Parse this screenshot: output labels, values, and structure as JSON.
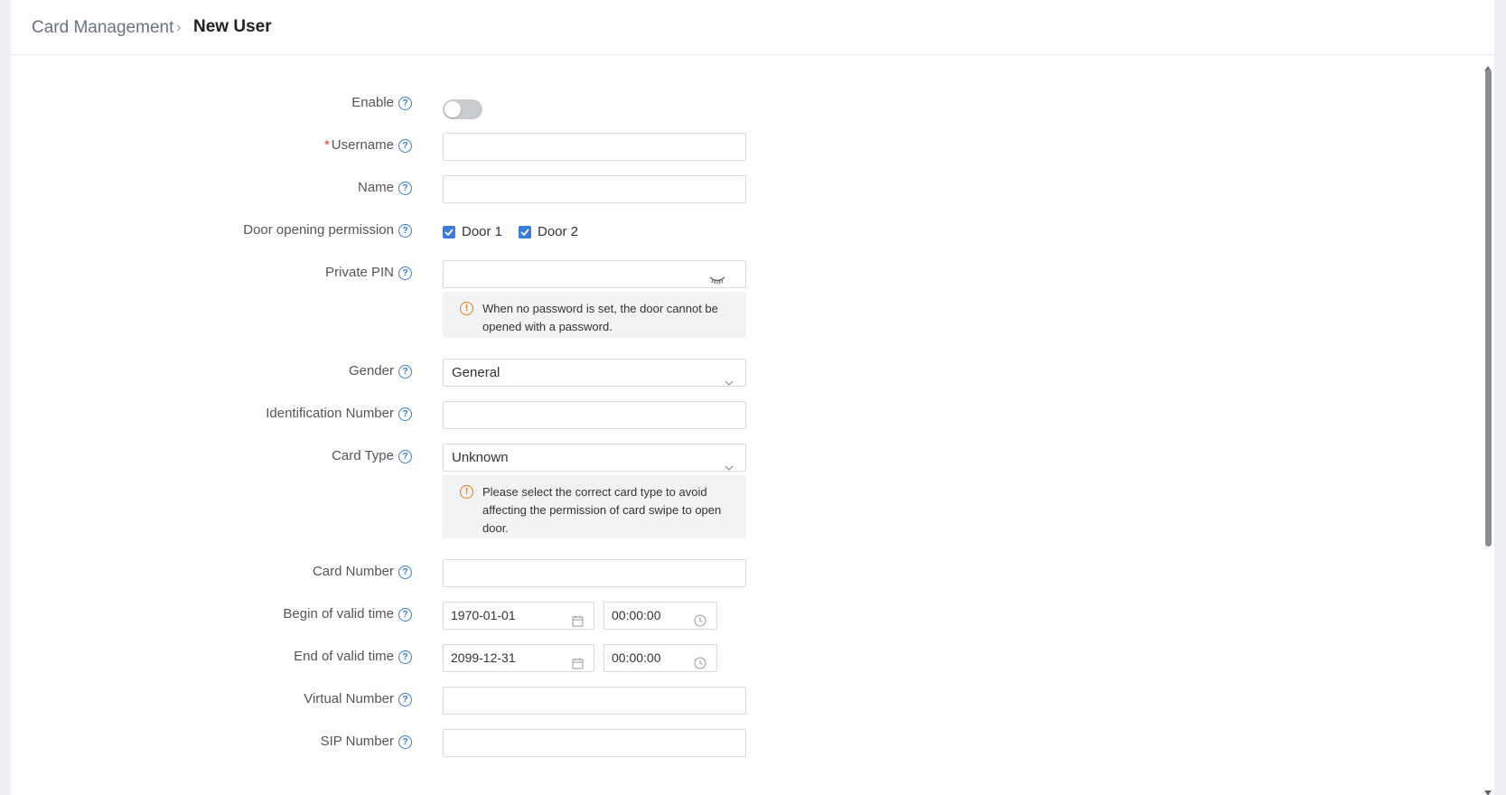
{
  "breadcrumb": {
    "parent": "Card Management",
    "separator": "›",
    "current": "New User"
  },
  "form": {
    "enable": {
      "label": "Enable",
      "state": "off"
    },
    "username": {
      "label": "Username",
      "required_mark": "*",
      "value": ""
    },
    "name": {
      "label": "Name",
      "value": ""
    },
    "door_permission": {
      "label": "Door opening permission",
      "options": [
        {
          "label": "Door 1",
          "checked": true
        },
        {
          "label": "Door 2",
          "checked": true
        }
      ]
    },
    "private_pin": {
      "label": "Private PIN",
      "value": "",
      "notice": "When no password is set, the door cannot be opened with a password."
    },
    "gender": {
      "label": "Gender",
      "value": "General"
    },
    "identification_number": {
      "label": "Identification Number",
      "value": ""
    },
    "card_type": {
      "label": "Card Type",
      "value": "Unknown",
      "notice": "Please select the correct card type to avoid affecting the permission of card swipe to open door."
    },
    "card_number": {
      "label": "Card Number",
      "value": ""
    },
    "begin_valid_time": {
      "label": "Begin of valid time",
      "date": "1970-01-01",
      "time": "00:00:00"
    },
    "end_valid_time": {
      "label": "End of valid time",
      "date": "2099-12-31",
      "time": "00:00:00"
    },
    "virtual_number": {
      "label": "Virtual Number",
      "value": ""
    },
    "sip_number": {
      "label": "SIP Number",
      "value": ""
    }
  },
  "icons": {
    "help": "question-circle-icon",
    "warning": "exclamation-circle-icon",
    "password_toggle": "eye-closed-icon",
    "dropdown": "chevron-down-icon",
    "calendar": "calendar-icon",
    "clock": "clock-icon"
  },
  "colors": {
    "accent": "#3a7bd5",
    "warning": "#e07b20",
    "required": "#e03a3a",
    "toggle_off": "#c8cbd0",
    "notice_bg": "#f2f3f5"
  },
  "glyphs": {
    "help": "?",
    "warning": "!"
  }
}
